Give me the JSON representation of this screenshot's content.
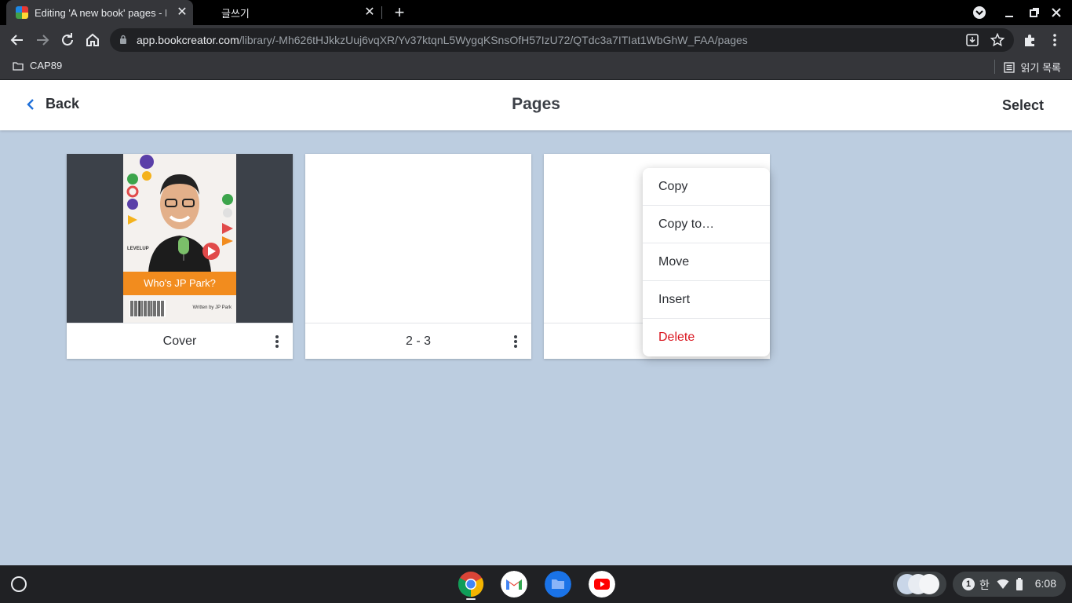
{
  "browser": {
    "tabs": [
      {
        "title": "Editing 'A new book' pages - Bo",
        "active": true
      },
      {
        "title": "글쓰기",
        "active": false
      }
    ],
    "url_host": "app.bookcreator.com",
    "url_path": "/library/-Mh626tHJkkzUuj6vqXR/Yv37ktqnL5WygqKSnsOfH57IzU72/QTdc3a7ITIat1WbGhW_FAA/pages",
    "bookmarks": [
      {
        "label": "CAP89"
      }
    ],
    "reading_list_label": "읽기 목록"
  },
  "app": {
    "back_label": "Back",
    "title": "Pages",
    "select_label": "Select",
    "cards": [
      {
        "label": "Cover"
      },
      {
        "label": "2 - 3"
      },
      {
        "label": ""
      }
    ],
    "cover": {
      "book_title": "Who's JP Park?",
      "written_by": "Written by JP Park",
      "badge": "LEVELUP"
    },
    "context_menu": [
      {
        "label": "Copy"
      },
      {
        "label": "Copy to…"
      },
      {
        "label": "Move"
      },
      {
        "label": "Insert"
      },
      {
        "label": "Delete",
        "danger": true
      }
    ]
  },
  "shelf": {
    "apps": [
      "chrome-icon",
      "gmail-icon",
      "files-icon",
      "youtube-icon"
    ],
    "ime": "한",
    "notification_count": "1",
    "time": "6:08"
  },
  "colors": {
    "accent_blue": "#1e6fd9",
    "danger_red": "#d9141e",
    "canvas_bg": "#bccde0",
    "cover_orange": "#f28c1e"
  }
}
